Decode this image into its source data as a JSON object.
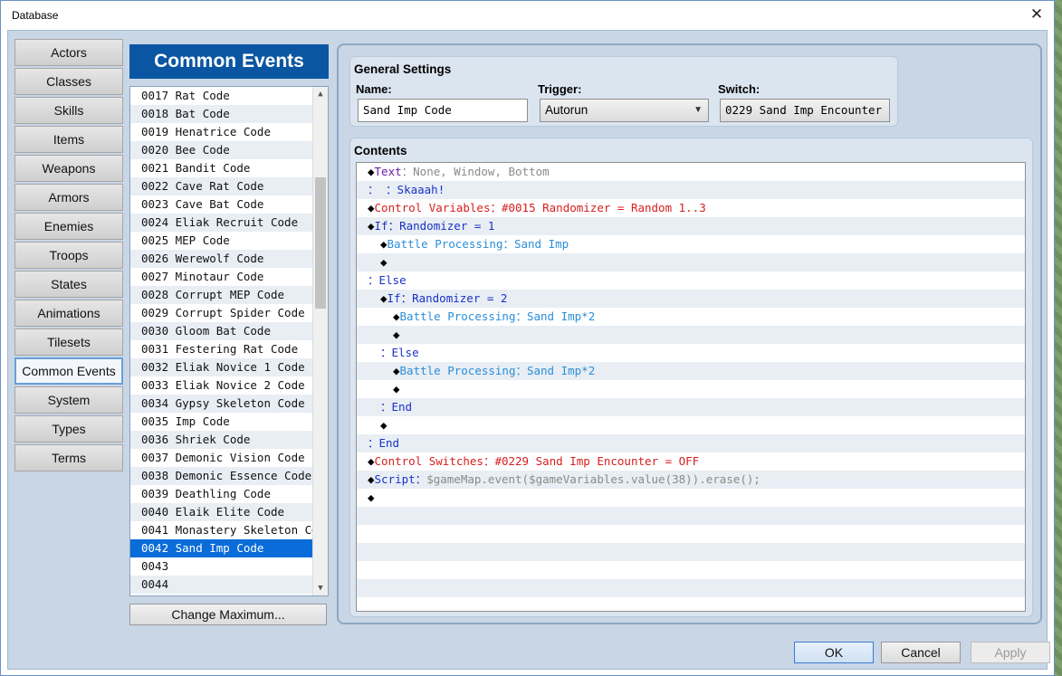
{
  "window": {
    "title": "Database",
    "close_glyph": "✕"
  },
  "categories": [
    {
      "label": "Actors"
    },
    {
      "label": "Classes"
    },
    {
      "label": "Skills"
    },
    {
      "label": "Items"
    },
    {
      "label": "Weapons"
    },
    {
      "label": "Armors"
    },
    {
      "label": "Enemies"
    },
    {
      "label": "Troops"
    },
    {
      "label": "States"
    },
    {
      "label": "Animations"
    },
    {
      "label": "Tilesets"
    },
    {
      "label": "Common Events",
      "active": true
    },
    {
      "label": "System"
    },
    {
      "label": "Types"
    },
    {
      "label": "Terms"
    }
  ],
  "list": {
    "header": "Common Events",
    "items": [
      "0017 Rat Code",
      "0018 Bat Code",
      "0019 Henatrice Code",
      "0020 Bee Code",
      "0021 Bandit Code",
      "0022 Cave Rat Code",
      "0023 Cave Bat Code",
      "0024 Eliak Recruit Code",
      "0025 MEP Code",
      "0026 Werewolf Code",
      "0027 Minotaur Code",
      "0028 Corrupt MEP Code",
      "0029 Corrupt Spider Code",
      "0030 Gloom Bat Code",
      "0031 Festering Rat Code",
      "0032 Eliak Novice 1 Code",
      "0033 Eliak Novice 2 Code",
      "0034 Gypsy Skeleton Code",
      "0035 Imp Code",
      "0036 Shriek Code",
      "0037 Demonic Vision Code",
      "0038 Demonic Essence Code",
      "0039 Deathling Code",
      "0040 Elaik Elite Code",
      "0041 Monastery Skeleton C⋯",
      "0042 Sand Imp Code",
      "0043",
      "0044"
    ],
    "selected_index": 25,
    "change_max_label": "Change Maximum..."
  },
  "general": {
    "title": "General Settings",
    "name_label": "Name:",
    "name_value": "Sand Imp Code",
    "trigger_label": "Trigger:",
    "trigger_value": "Autorun",
    "switch_label": "Switch:",
    "switch_value": "0229 Sand Imp Encounter ⋯"
  },
  "contents": {
    "title": "Contents",
    "lines": [
      {
        "indent": 0,
        "parts": [
          {
            "t": "◆",
            "c": "black"
          },
          {
            "t": "Text",
            "c": "purple"
          },
          {
            "t": "：None, Window, Bottom",
            "c": "gray"
          }
        ]
      },
      {
        "indent": 0,
        "parts": [
          {
            "t": "：",
            "c": "purple"
          },
          {
            "t": "    ：Skaaah!",
            "c": "blue"
          }
        ]
      },
      {
        "indent": 0,
        "parts": [
          {
            "t": "◆",
            "c": "black"
          },
          {
            "t": "Control Variables：#0015 Randomizer = Random 1..3",
            "c": "red"
          }
        ]
      },
      {
        "indent": 0,
        "parts": [
          {
            "t": "◆",
            "c": "black"
          },
          {
            "t": "If：Randomizer = 1",
            "c": "blue"
          }
        ]
      },
      {
        "indent": 1,
        "parts": [
          {
            "t": "◆",
            "c": "black"
          },
          {
            "t": "Battle Processing：Sand Imp",
            "c": "cyan"
          }
        ]
      },
      {
        "indent": 1,
        "parts": [
          {
            "t": "◆",
            "c": "black"
          }
        ]
      },
      {
        "indent": 0,
        "parts": [
          {
            "t": "：Else",
            "c": "blue"
          }
        ]
      },
      {
        "indent": 1,
        "parts": [
          {
            "t": "◆",
            "c": "black"
          },
          {
            "t": "If：Randomizer = 2",
            "c": "blue"
          }
        ]
      },
      {
        "indent": 2,
        "parts": [
          {
            "t": "◆",
            "c": "black"
          },
          {
            "t": "Battle Processing：Sand Imp*2",
            "c": "cyan"
          }
        ]
      },
      {
        "indent": 2,
        "parts": [
          {
            "t": "◆",
            "c": "black"
          }
        ]
      },
      {
        "indent": 1,
        "parts": [
          {
            "t": "：Else",
            "c": "blue"
          }
        ]
      },
      {
        "indent": 2,
        "parts": [
          {
            "t": "◆",
            "c": "black"
          },
          {
            "t": "Battle Processing：Sand Imp*2",
            "c": "cyan"
          }
        ]
      },
      {
        "indent": 2,
        "parts": [
          {
            "t": "◆",
            "c": "black"
          }
        ]
      },
      {
        "indent": 1,
        "parts": [
          {
            "t": "：End",
            "c": "blue"
          }
        ]
      },
      {
        "indent": 1,
        "parts": [
          {
            "t": "◆",
            "c": "black"
          }
        ]
      },
      {
        "indent": 0,
        "parts": [
          {
            "t": "：End",
            "c": "blue"
          }
        ]
      },
      {
        "indent": 0,
        "parts": [
          {
            "t": "◆",
            "c": "black"
          },
          {
            "t": "Control Switches：#0229 Sand Imp Encounter = OFF",
            "c": "red"
          }
        ]
      },
      {
        "indent": 0,
        "parts": [
          {
            "t": "◆",
            "c": "black"
          },
          {
            "t": "Script：",
            "c": "blue"
          },
          {
            "t": "$gameMap.event($gameVariables.value(38)).erase();",
            "c": "gray"
          }
        ]
      },
      {
        "indent": 0,
        "parts": [
          {
            "t": "◆",
            "c": "black"
          }
        ]
      },
      {
        "indent": 0,
        "parts": []
      },
      {
        "indent": 0,
        "parts": []
      },
      {
        "indent": 0,
        "parts": []
      },
      {
        "indent": 0,
        "parts": []
      },
      {
        "indent": 0,
        "parts": []
      },
      {
        "indent": 0,
        "parts": []
      }
    ]
  },
  "footer": {
    "ok": "OK",
    "cancel": "Cancel",
    "apply": "Apply"
  }
}
